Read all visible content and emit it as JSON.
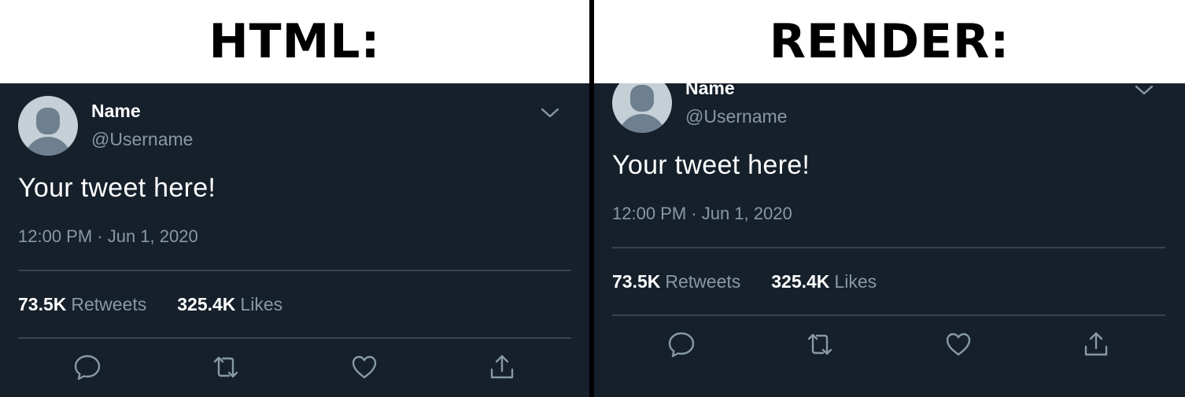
{
  "headers": {
    "left": "HTML:",
    "right": "RENDER:"
  },
  "tweet": {
    "name": "Name",
    "username": "@Username",
    "text": "Your tweet here!",
    "timestamp": "12:00 PM · Jun 1, 2020",
    "retweets_count": "73.5K",
    "retweets_label": "Retweets",
    "likes_count": "325.4K",
    "likes_label": "Likes"
  },
  "icons": {
    "caret": "chevron-down-icon",
    "reply": "reply-icon",
    "retweet": "retweet-icon",
    "like": "heart-icon",
    "share": "share-icon"
  },
  "colors": {
    "background": "#15202b",
    "text_primary": "#ffffff",
    "text_secondary": "#8899a6",
    "rule": "#38444d",
    "avatar_bg": "#c4cfd6",
    "avatar_fg": "#6e7f8f"
  }
}
